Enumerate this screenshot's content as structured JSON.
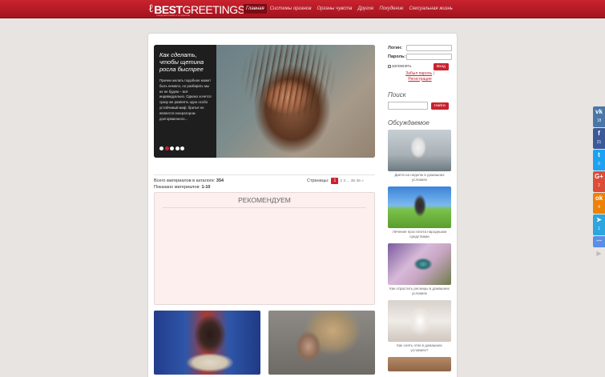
{
  "header": {
    "logo_bold": "BEST",
    "logo_thin": "GREETINGS",
    "logo_sub": "поздравления и открытки",
    "nav": [
      "Главная",
      "Системы органов",
      "Органы чувств",
      "Другое",
      "Похудение",
      "Сексуальная жизнь"
    ],
    "active_nav": 0
  },
  "slider": {
    "title": "Как сделать, чтобы щетина росла быстрее",
    "description": "Причин желать подобное может быть немало, но разбирать мы их не будем – всё индивидуально. Однако хочется сразу же развеять одно особо устойчивый миф: бритьё не является генератором долгорваенного...",
    "dots": 5,
    "active_dot": 1
  },
  "catalog": {
    "total_label": "Всего материалов в каталоге:",
    "total_value": "354",
    "shown_label": "Показано материалов:",
    "shown_value": "1-10"
  },
  "pager": {
    "label": "Страницы:",
    "current": "1",
    "rest": "2 3 ... 35 36 »"
  },
  "recommend": {
    "title": "РЕКОМЕНДУЕМ"
  },
  "login": {
    "login_label": "Логин:",
    "password_label": "Пароль:",
    "remember": "запомнить",
    "submit": "Вход",
    "forgot": "Забыл пароль",
    "separator": "|",
    "register": "Регистрация"
  },
  "search": {
    "heading": "Поиск",
    "button": "Найти"
  },
  "discussed": {
    "heading": "Обсуждаемое",
    "items": [
      "Диета на неделю в домашних условиях",
      "Лечение простатита народными средствами",
      "Как отрастить ресницы в домашних условиях",
      "Как снять отек в домашних условиях?"
    ]
  },
  "social": {
    "vk": {
      "icon": "vk",
      "count": "18"
    },
    "fb": {
      "icon": "f",
      "count": "21"
    },
    "tw": {
      "icon": "t",
      "count": "0"
    },
    "gp": {
      "icon": "G+",
      "count": "2"
    },
    "ok": {
      "icon": "ok",
      "count": "4"
    },
    "tg": {
      "icon": "➤",
      "count": "1"
    },
    "more": "⋯",
    "arrow": "▶"
  }
}
